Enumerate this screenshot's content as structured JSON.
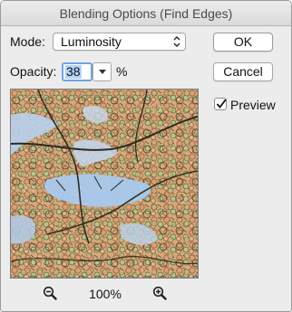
{
  "window": {
    "title": "Blending Options (Find Edges)"
  },
  "mode": {
    "label": "Mode:",
    "value": "Luminosity"
  },
  "opacity": {
    "label": "Opacity:",
    "value": "38",
    "unit": "%"
  },
  "buttons": {
    "ok": "OK",
    "cancel": "Cancel"
  },
  "preview": {
    "label": "Preview",
    "checked": true
  },
  "zoom": {
    "level": "100%"
  },
  "colors": {
    "selection": "#b4d4fb",
    "focus_ring": "#6fa3e8",
    "dialog_bg": "#ececec"
  }
}
